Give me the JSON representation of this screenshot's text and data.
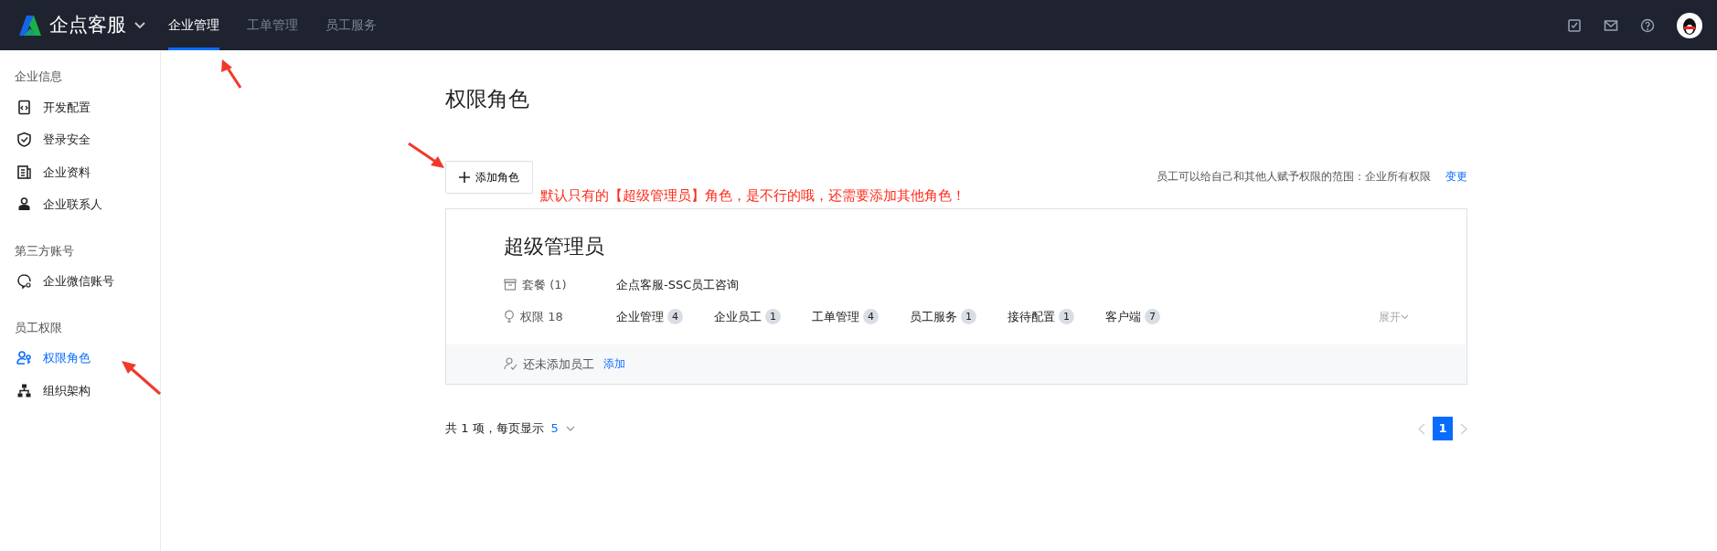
{
  "brand": {
    "name": "企点客服"
  },
  "top_nav": [
    {
      "label": "企业管理",
      "selected": true
    },
    {
      "label": "工单管理",
      "selected": false
    },
    {
      "label": "员工服务",
      "selected": false
    }
  ],
  "header_icons": [
    {
      "kind": "todo"
    },
    {
      "kind": "mail"
    },
    {
      "kind": "help"
    }
  ],
  "sidebar": {
    "groups": [
      {
        "title": "企业信息",
        "items": [
          {
            "label": "开发配置",
            "kind": "code",
            "selected": false
          },
          {
            "label": "登录安全",
            "kind": "shield",
            "selected": false
          },
          {
            "label": "企业资料",
            "kind": "doc",
            "selected": false
          },
          {
            "label": "企业联系人",
            "kind": "person",
            "selected": false
          }
        ]
      },
      {
        "title": "第三方账号",
        "items": [
          {
            "label": "企业微信账号",
            "kind": "chat",
            "selected": false
          }
        ]
      },
      {
        "title": "员工权限",
        "items": [
          {
            "label": "权限角色",
            "kind": "role",
            "selected": true
          },
          {
            "label": "组织架构",
            "kind": "org",
            "selected": false
          }
        ]
      }
    ]
  },
  "page": {
    "title": "权限角色",
    "add_button": "添加角色",
    "annotation": "默认只有的【超级管理员】角色，是不行的哦，还需要添加其他角色！",
    "scope_text": "员工可以给自己和其他人赋予权限的范围：企业所有权限",
    "scope_link": "变更"
  },
  "roles": [
    {
      "name": "超级管理员",
      "package_label": "套餐 (1)",
      "package_value": "企点客服-SSC员工咨询",
      "permission_label": "权限 18",
      "permissions": [
        {
          "name": "企业管理",
          "count": "4"
        },
        {
          "name": "企业员工",
          "count": "1"
        },
        {
          "name": "工单管理",
          "count": "4"
        },
        {
          "name": "员工服务",
          "count": "1"
        },
        {
          "name": "接待配置",
          "count": "1"
        },
        {
          "name": "客户端",
          "count": "7"
        }
      ],
      "expand": "展开",
      "empty_staff": "还未添加员工",
      "add_staff": "添加"
    }
  ],
  "pagination": {
    "summary": "共 1 项，每页显示",
    "page_size": "5",
    "pages": [
      {
        "label": "1",
        "selected": true
      }
    ]
  }
}
